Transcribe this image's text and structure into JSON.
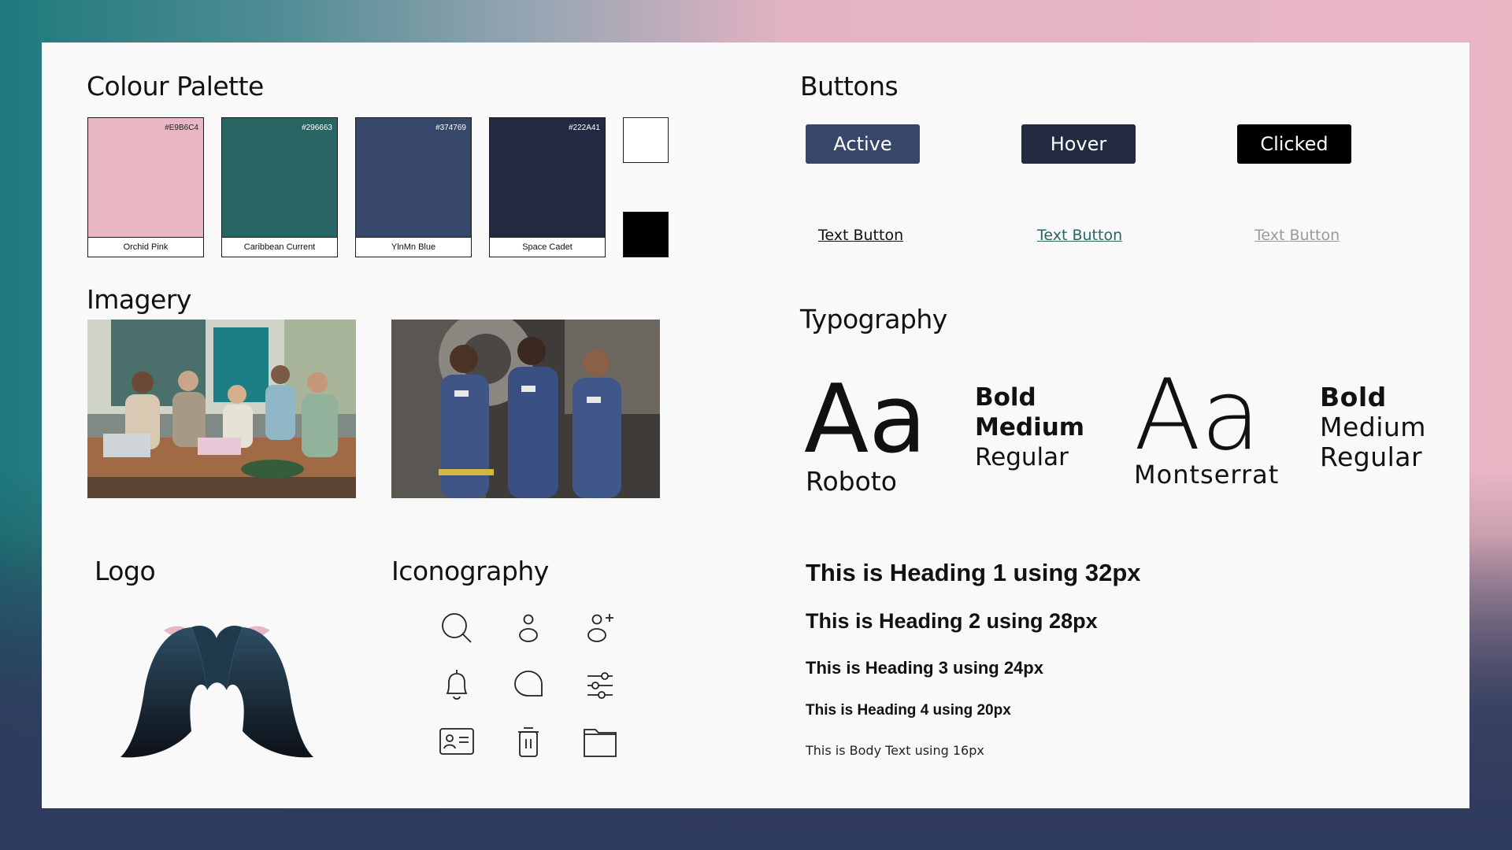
{
  "sections": {
    "palette_title": "Colour Palette",
    "imagery_title": "Imagery",
    "logo_title": "Logo",
    "iconography_title": "Iconography",
    "buttons_title": "Buttons",
    "typography_title": "Typography"
  },
  "palette": [
    {
      "hex": "#E9B6C4",
      "name": "Orchid Pink",
      "color": "#e9b6c4"
    },
    {
      "hex": "#296663",
      "name": "Caribbean Current",
      "color": "#296663"
    },
    {
      "hex": "#374769",
      "name": "YlnMn Blue",
      "color": "#374769"
    },
    {
      "hex": "#222A41",
      "name": "Space Cadet",
      "color": "#222a41"
    }
  ],
  "palette_extra_colors": [
    "#ffffff",
    "#000000"
  ],
  "buttons": {
    "active": "Active",
    "hover": "Hover",
    "clicked": "Clicked",
    "text_default": "Text Button",
    "text_hover": "Text Button",
    "text_disabled": "Text Button",
    "colors": {
      "active": "#374769",
      "hover": "#222a41",
      "clicked": "#000000",
      "text_hover": "#296663",
      "text_disabled": "#9a9a9a"
    }
  },
  "typography": {
    "sample": "Aa",
    "font1": "Roboto",
    "font2": "Montserrat",
    "weights1": [
      "Bold",
      "Medium",
      "Regular"
    ],
    "weights2": [
      "Bold",
      "Medium",
      "Regular"
    ]
  },
  "headings": {
    "h1": "This is Heading 1 using 32px",
    "h2": "This is Heading 2 using 28px",
    "h3": "This is Heading 3 using 24px",
    "h4": "This is Heading 4 using 20px",
    "body": "This is Body Text using 16px"
  },
  "icons": [
    "search-icon",
    "user-icon",
    "add-user-icon",
    "bell-icon",
    "chat-bubble-icon",
    "sliders-icon",
    "id-card-icon",
    "trash-icon",
    "folder-icon"
  ]
}
